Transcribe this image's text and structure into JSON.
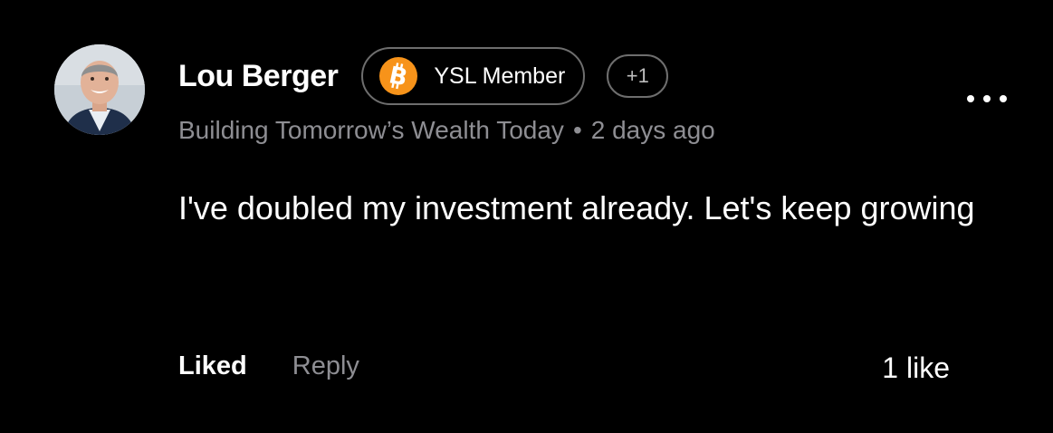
{
  "comment": {
    "author": {
      "name": "Lou Berger",
      "subtitle": "Building Tomorrow’s Wealth Today",
      "avatar_icon": "profile-photo"
    },
    "badge": {
      "icon": "bitcoin-icon",
      "label": "YSL Member",
      "icon_color": "#f7931a"
    },
    "extra_badges": "+1",
    "separator": "•",
    "timestamp": "2 days ago",
    "text": "I've doubled my investment already. Let's keep growing",
    "actions": {
      "like_label": "Liked",
      "reply_label": "Reply"
    },
    "like_count": "1 like",
    "more_icon": "more-horizontal-icon"
  },
  "colors": {
    "background": "#000000",
    "primary_text": "#ffffff",
    "secondary_text": "#8e8e93",
    "border": "#6e6e6e"
  }
}
